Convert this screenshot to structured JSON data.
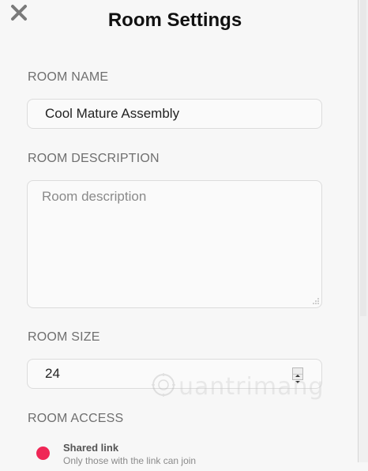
{
  "header": {
    "title": "Room Settings"
  },
  "room_name": {
    "label": "ROOM NAME",
    "value": "Cool Mature Assembly"
  },
  "room_description": {
    "label": "ROOM DESCRIPTION",
    "placeholder": "Room description"
  },
  "room_size": {
    "label": "ROOM SIZE",
    "value": "24"
  },
  "room_access": {
    "label": "ROOM ACCESS",
    "options": [
      {
        "title": "Shared link",
        "subtitle": "Only those with the link can join",
        "selected": true
      }
    ]
  },
  "watermark": {
    "text": "uantrimang",
    "icon": "lightbulb-icon"
  },
  "colors": {
    "accent": "#ef2756",
    "background": "#f7f7f7",
    "label": "#6f6f6f"
  }
}
